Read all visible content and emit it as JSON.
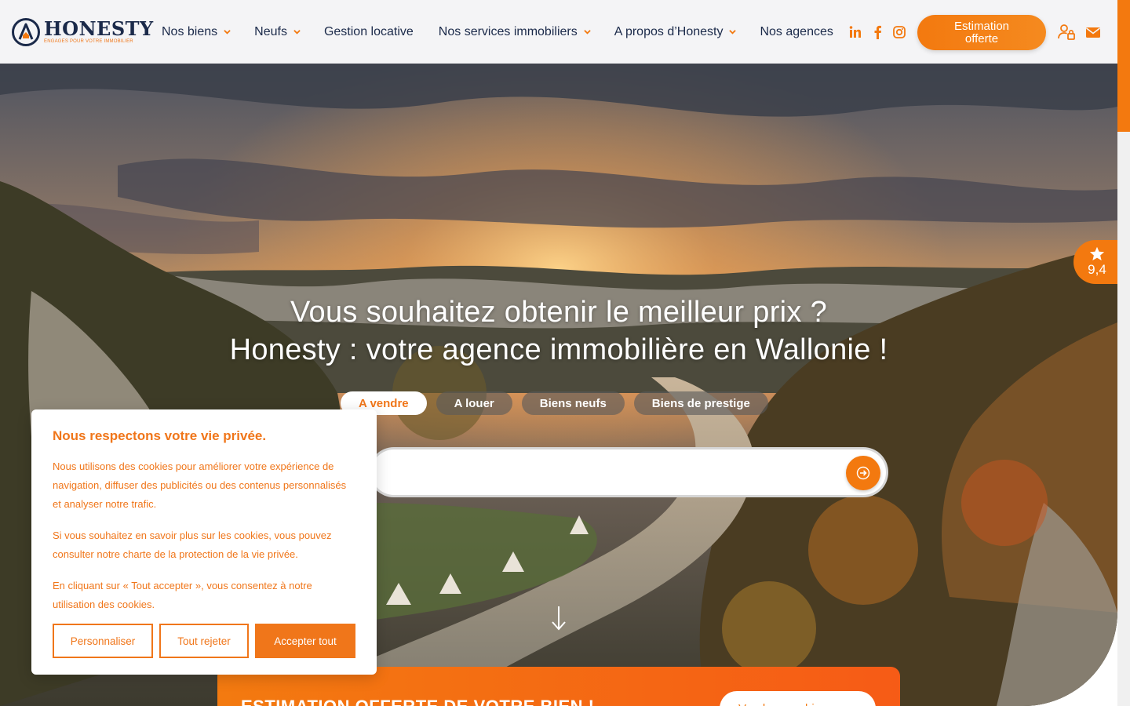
{
  "brand": {
    "name": "HONESTY",
    "tagline": "ENGAGES POUR VOTRE IMMOBILIER",
    "accent": "#f3790f",
    "navy": "#1b2a4a"
  },
  "nav": {
    "items": [
      {
        "label": "Nos biens",
        "dropdown": true
      },
      {
        "label": "Neufs",
        "dropdown": true
      },
      {
        "label": "Gestion locative",
        "dropdown": false
      },
      {
        "label": "Nos services immobiliers",
        "dropdown": true
      },
      {
        "label": "A propos d’Honesty",
        "dropdown": true
      },
      {
        "label": "Nos agences",
        "dropdown": false
      }
    ]
  },
  "socials": [
    "linkedin-icon",
    "facebook-icon",
    "instagram-icon"
  ],
  "header": {
    "estimation_label": "Estimation offerte",
    "account_icon": "user-lock-icon",
    "mail_icon": "envelope-icon"
  },
  "hero": {
    "title_line1": "Vous souhaitez obtenir le meilleur prix ?",
    "title_line2": "Honesty : votre agence immobilière en Wallonie !",
    "tabs": [
      {
        "label": "A vendre",
        "active": true
      },
      {
        "label": "A louer",
        "active": false
      },
      {
        "label": "Biens neufs",
        "active": false
      },
      {
        "label": "Biens de prestige",
        "active": false
      }
    ],
    "search_placeholder": "",
    "search_icon": "arrow-right-icon",
    "scroll_icon": "arrow-down-icon"
  },
  "rating": {
    "value": "9,4",
    "icon": "star-icon"
  },
  "estimation_banner": {
    "title": "ESTIMATION OFFERTE DE VOTRE BIEN !",
    "button_label": "Vendre mon bien"
  },
  "cookie": {
    "title": "Nous respectons votre vie privée.",
    "p1": "Nous utilisons des cookies pour améliorer votre expérience de navigation, diffuser des publicités ou des contenus personnalisés et analyser notre trafic.",
    "p2": "Si vous souhaitez en savoir plus sur les cookies, vous pouvez consulter notre charte de la protection de la vie privée.",
    "p3": "En cliquant sur « Tout accepter », vous consentez à notre utilisation des cookies.",
    "btn_customize": "Personnaliser",
    "btn_reject": "Tout rejeter",
    "btn_accept": "Accepter tout"
  }
}
